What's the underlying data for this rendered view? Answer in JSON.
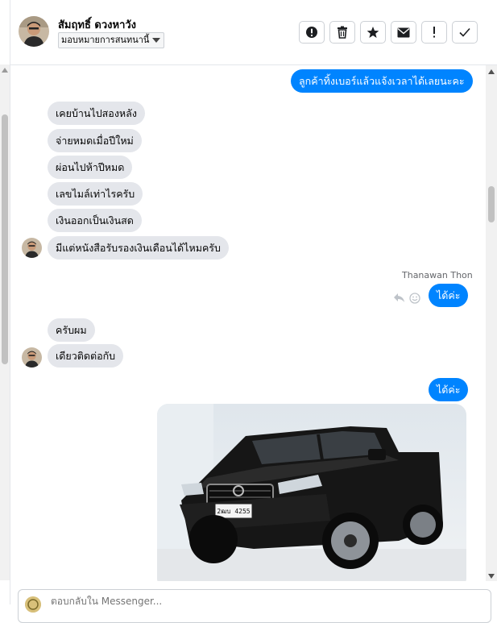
{
  "header": {
    "contact_name": "สัมฤทธิ์ ดวงหาวัง",
    "assign_label": "มอบหมายการสนทนานี้",
    "actions": [
      {
        "icon": "alert-circle-icon",
        "label": "!"
      },
      {
        "icon": "trash-icon",
        "label": ""
      },
      {
        "icon": "star-icon",
        "label": ""
      },
      {
        "icon": "envelope-icon",
        "label": ""
      },
      {
        "icon": "exclamation-icon",
        "label": "!"
      },
      {
        "icon": "checkmark-icon",
        "label": "✓"
      }
    ]
  },
  "messages": {
    "m1": "ลูกค้าทิ้งเบอร์แล้วแจ้งเวลาได้เลยนะคะ",
    "m2": "เคยบ้านไปสองหลัง",
    "m3": "จ่ายหมดเมื่อปีใหม่",
    "m4": "ผ่อนไปห้าปีหมด",
    "m5": "เลขไมล์เท่าไรครับ",
    "m6": "เงินออกเป็นเงินสด",
    "m7": "มีแต่หนังสือรับรองเงินเดือนได้ไหมครับ",
    "sender": "Thanawan Thon",
    "m8": "ได้ค่ะ",
    "m9": "ครับผม",
    "m10": "เดียวติดต่อกับ",
    "m11": "ได้ค่ะ",
    "plate": "2ฒบ 4255"
  },
  "composer": {
    "placeholder": "ตอบกลับใน Messenger..."
  },
  "colors": {
    "outgoing": "#0084ff",
    "incoming": "#e4e6eb"
  }
}
